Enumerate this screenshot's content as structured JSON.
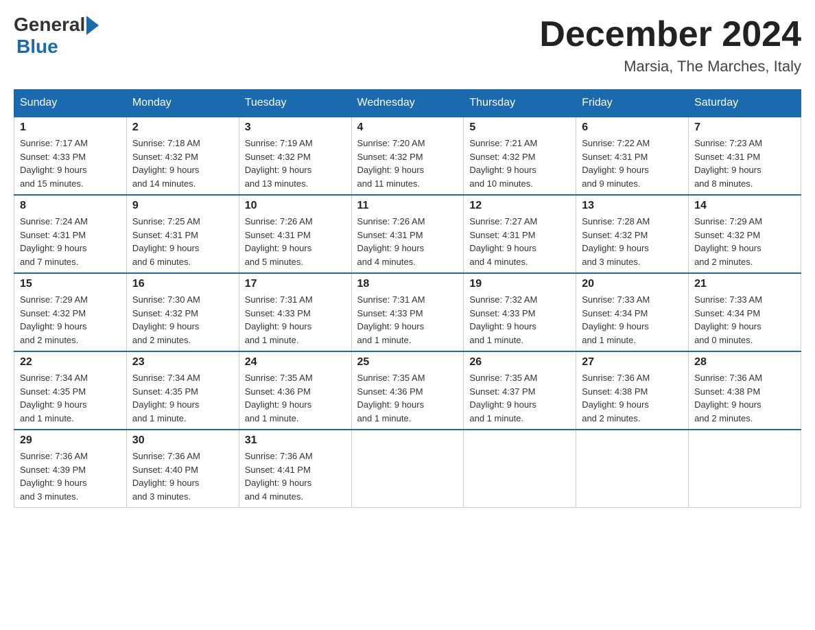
{
  "logo": {
    "general": "General",
    "blue": "Blue"
  },
  "title": "December 2024",
  "location": "Marsia, The Marches, Italy",
  "days_of_week": [
    "Sunday",
    "Monday",
    "Tuesday",
    "Wednesday",
    "Thursday",
    "Friday",
    "Saturday"
  ],
  "weeks": [
    [
      {
        "day": "1",
        "sunrise": "7:17 AM",
        "sunset": "4:33 PM",
        "daylight": "9 hours and 15 minutes."
      },
      {
        "day": "2",
        "sunrise": "7:18 AM",
        "sunset": "4:32 PM",
        "daylight": "9 hours and 14 minutes."
      },
      {
        "day": "3",
        "sunrise": "7:19 AM",
        "sunset": "4:32 PM",
        "daylight": "9 hours and 13 minutes."
      },
      {
        "day": "4",
        "sunrise": "7:20 AM",
        "sunset": "4:32 PM",
        "daylight": "9 hours and 11 minutes."
      },
      {
        "day": "5",
        "sunrise": "7:21 AM",
        "sunset": "4:32 PM",
        "daylight": "9 hours and 10 minutes."
      },
      {
        "day": "6",
        "sunrise": "7:22 AM",
        "sunset": "4:31 PM",
        "daylight": "9 hours and 9 minutes."
      },
      {
        "day": "7",
        "sunrise": "7:23 AM",
        "sunset": "4:31 PM",
        "daylight": "9 hours and 8 minutes."
      }
    ],
    [
      {
        "day": "8",
        "sunrise": "7:24 AM",
        "sunset": "4:31 PM",
        "daylight": "9 hours and 7 minutes."
      },
      {
        "day": "9",
        "sunrise": "7:25 AM",
        "sunset": "4:31 PM",
        "daylight": "9 hours and 6 minutes."
      },
      {
        "day": "10",
        "sunrise": "7:26 AM",
        "sunset": "4:31 PM",
        "daylight": "9 hours and 5 minutes."
      },
      {
        "day": "11",
        "sunrise": "7:26 AM",
        "sunset": "4:31 PM",
        "daylight": "9 hours and 4 minutes."
      },
      {
        "day": "12",
        "sunrise": "7:27 AM",
        "sunset": "4:31 PM",
        "daylight": "9 hours and 4 minutes."
      },
      {
        "day": "13",
        "sunrise": "7:28 AM",
        "sunset": "4:32 PM",
        "daylight": "9 hours and 3 minutes."
      },
      {
        "day": "14",
        "sunrise": "7:29 AM",
        "sunset": "4:32 PM",
        "daylight": "9 hours and 2 minutes."
      }
    ],
    [
      {
        "day": "15",
        "sunrise": "7:29 AM",
        "sunset": "4:32 PM",
        "daylight": "9 hours and 2 minutes."
      },
      {
        "day": "16",
        "sunrise": "7:30 AM",
        "sunset": "4:32 PM",
        "daylight": "9 hours and 2 minutes."
      },
      {
        "day": "17",
        "sunrise": "7:31 AM",
        "sunset": "4:33 PM",
        "daylight": "9 hours and 1 minute."
      },
      {
        "day": "18",
        "sunrise": "7:31 AM",
        "sunset": "4:33 PM",
        "daylight": "9 hours and 1 minute."
      },
      {
        "day": "19",
        "sunrise": "7:32 AM",
        "sunset": "4:33 PM",
        "daylight": "9 hours and 1 minute."
      },
      {
        "day": "20",
        "sunrise": "7:33 AM",
        "sunset": "4:34 PM",
        "daylight": "9 hours and 1 minute."
      },
      {
        "day": "21",
        "sunrise": "7:33 AM",
        "sunset": "4:34 PM",
        "daylight": "9 hours and 0 minutes."
      }
    ],
    [
      {
        "day": "22",
        "sunrise": "7:34 AM",
        "sunset": "4:35 PM",
        "daylight": "9 hours and 1 minute."
      },
      {
        "day": "23",
        "sunrise": "7:34 AM",
        "sunset": "4:35 PM",
        "daylight": "9 hours and 1 minute."
      },
      {
        "day": "24",
        "sunrise": "7:35 AM",
        "sunset": "4:36 PM",
        "daylight": "9 hours and 1 minute."
      },
      {
        "day": "25",
        "sunrise": "7:35 AM",
        "sunset": "4:36 PM",
        "daylight": "9 hours and 1 minute."
      },
      {
        "day": "26",
        "sunrise": "7:35 AM",
        "sunset": "4:37 PM",
        "daylight": "9 hours and 1 minute."
      },
      {
        "day": "27",
        "sunrise": "7:36 AM",
        "sunset": "4:38 PM",
        "daylight": "9 hours and 2 minutes."
      },
      {
        "day": "28",
        "sunrise": "7:36 AM",
        "sunset": "4:38 PM",
        "daylight": "9 hours and 2 minutes."
      }
    ],
    [
      {
        "day": "29",
        "sunrise": "7:36 AM",
        "sunset": "4:39 PM",
        "daylight": "9 hours and 3 minutes."
      },
      {
        "day": "30",
        "sunrise": "7:36 AM",
        "sunset": "4:40 PM",
        "daylight": "9 hours and 3 minutes."
      },
      {
        "day": "31",
        "sunrise": "7:36 AM",
        "sunset": "4:41 PM",
        "daylight": "9 hours and 4 minutes."
      },
      null,
      null,
      null,
      null
    ]
  ],
  "labels": {
    "sunrise": "Sunrise:",
    "sunset": "Sunset:",
    "daylight": "Daylight:"
  },
  "accent_color": "#1a6aad"
}
